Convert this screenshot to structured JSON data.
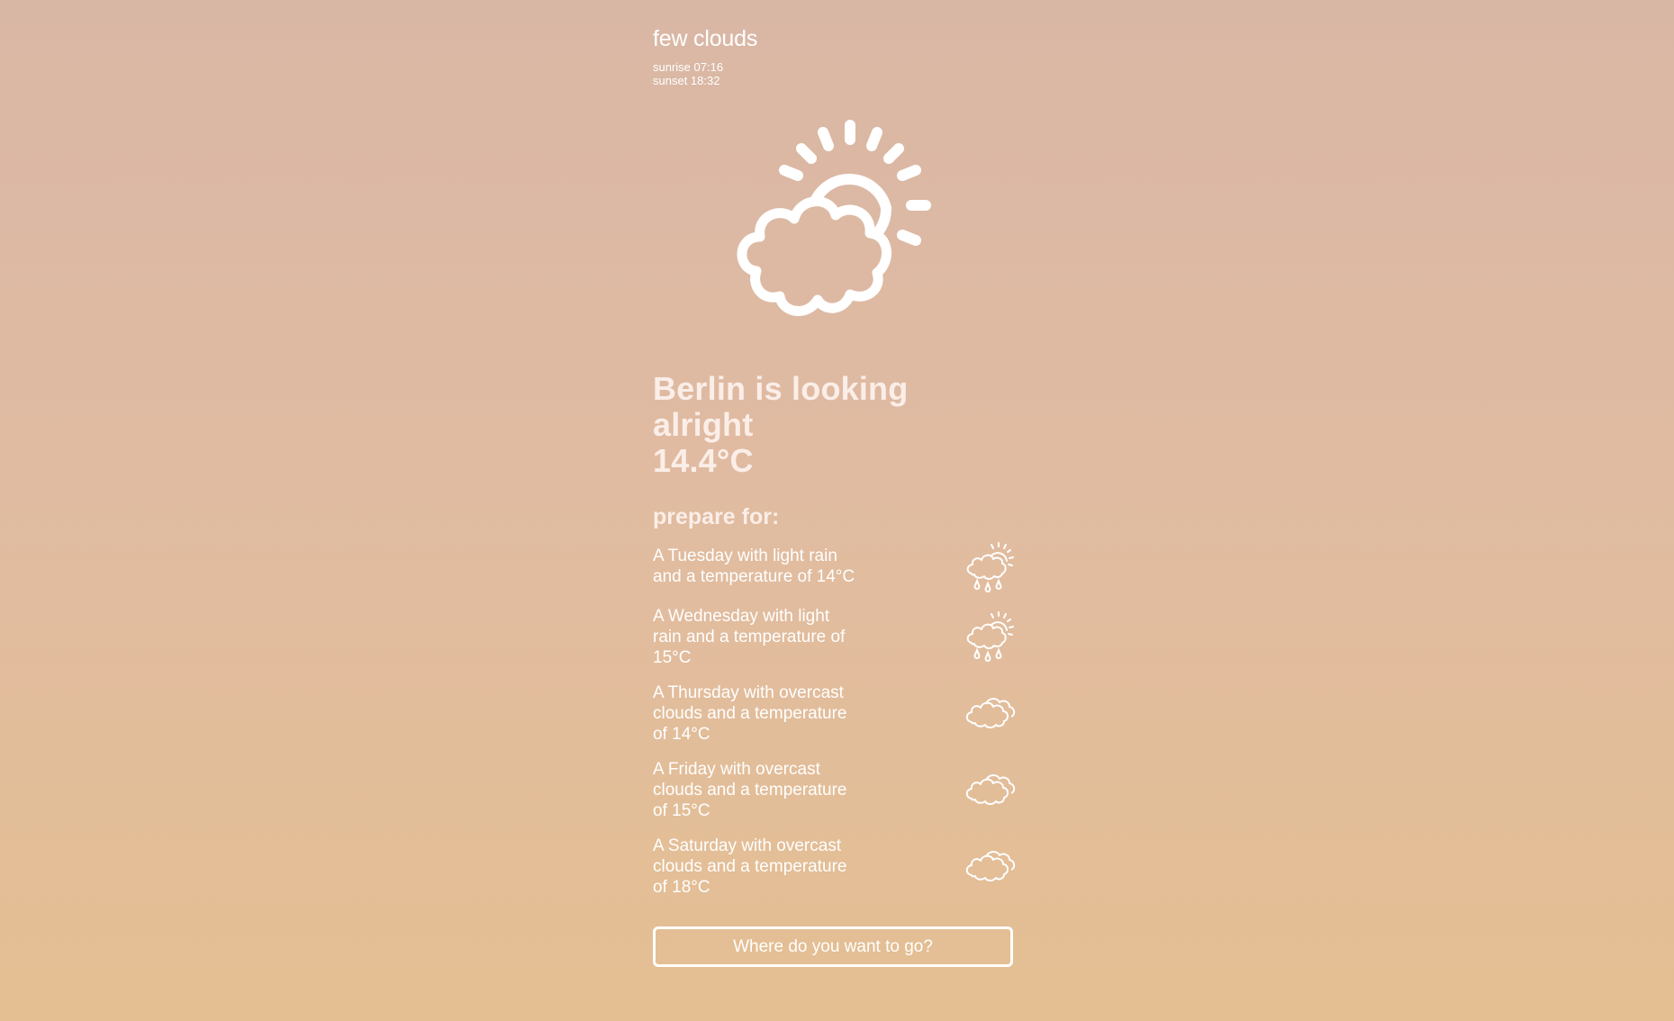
{
  "current": {
    "condition": "few clouds",
    "sunrise": "sunrise 07:16",
    "sunset": "sunset 18:32",
    "icon": "sun-behind-cloud-icon",
    "headline_line1": "Berlin is looking alright",
    "headline_line2": "14.4°C"
  },
  "forecast": {
    "heading": "prepare for:",
    "items": [
      {
        "text": "A Tuesday with light rain and a temperature of 14°C",
        "icon": "sun-cloud-rain-icon"
      },
      {
        "text": "A Wednesday with light rain and a temperature of 15°C",
        "icon": "sun-cloud-rain-icon"
      },
      {
        "text": "A Thursday with overcast clouds and a temperature of 14°C",
        "icon": "clouds-icon"
      },
      {
        "text": "A Friday with overcast clouds and a temperature of 15°C",
        "icon": "clouds-icon"
      },
      {
        "text": "A Saturday with overcast clouds and a temperature of 18°C",
        "icon": "clouds-icon"
      }
    ]
  },
  "search": {
    "placeholder": "Where do you want to go?"
  },
  "colors": {
    "bg_top": "#d9b7a5",
    "bg_bottom": "#e4bf92",
    "text": "#ffffff"
  }
}
